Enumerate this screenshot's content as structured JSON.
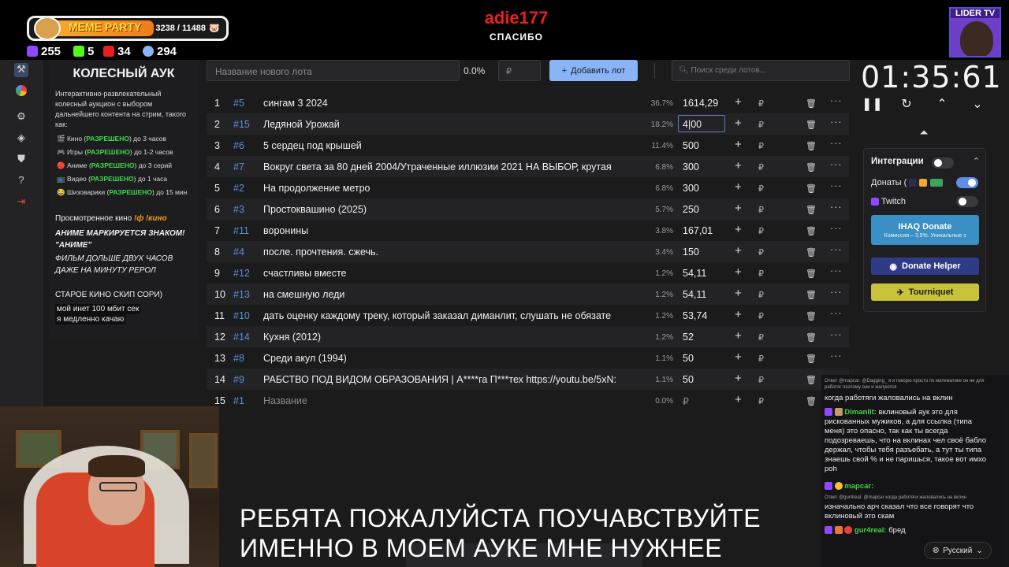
{
  "overlay": {
    "meme_party_label": "MEME PARTY",
    "meme_count": "3238 / 11488",
    "stats": [
      {
        "icon": "twitch-icon",
        "value": "255",
        "color": "#9146ff"
      },
      {
        "icon": "kick-icon",
        "value": "5",
        "color": "#53fc18"
      },
      {
        "icon": "live-icon",
        "value": "34",
        "color": "#e8201d"
      },
      {
        "icon": "viewers-icon",
        "value": "294",
        "color": "#8ab4f8"
      }
    ],
    "donor_name": "adie177",
    "thanks": "СПАСИБО",
    "lider_tv": "LIDER TV"
  },
  "sidebar_rules": {
    "title": "КОЛЕСНЫЙ АУК",
    "intro": "Интерактивно-развлекательный колесный аукцион с выбором дальнейшего контента на стрим, такого как:",
    "items": [
      {
        "before": "Кино (",
        "allowed": "РАЗРЕШЕНО",
        "after": ") до 3 часов"
      },
      {
        "before": "Игры (",
        "allowed": "РАЗРЕШЕНО",
        "after": ") до 1-2 часов"
      },
      {
        "before": "Аниме (",
        "allowed": "РАЗРЕШЕНО",
        "after": ") до 3 серий"
      },
      {
        "before": "Видео (",
        "allowed": "РАЗРЕШЕНО",
        "after": ") до 1 часа"
      },
      {
        "before": "Шизоварики (",
        "allowed": "РАЗРЕШЕНО",
        "after": ") до 15 мин"
      }
    ],
    "watched_prefix": "Просмотренное кино",
    "watched_cmd": "!ф !кино",
    "anime_note": "АНИМЕ МАРКИРУЕТСЯ ЗНАКОМ! \"АНИМЕ\"",
    "film_note": "ФИЛЬМ ДОЛЬШЕ ДВУХ ЧАСОВ ДАЖЕ НА МИНУТУ РЕРОЛ",
    "old_cinema": "СТАРОЕ КИНО СКИП СОРИ)",
    "internet_1": "мой инет 100 мбит сек",
    "internet_2": "я медленно качаю"
  },
  "controls": {
    "lot_placeholder": "Название нового лота",
    "percent": "0.0%",
    "currency_placeholder": "₽",
    "add_button": "Добавить лот",
    "search_placeholder": "Поиск среди лотов..."
  },
  "lots": [
    {
      "num": "1",
      "id": "#5",
      "name": "сингам 3 2024",
      "pct": "36.7%",
      "amount": "1614,29"
    },
    {
      "num": "2",
      "id": "#15",
      "name": " Ледяной Урожай",
      "pct": "18.2%",
      "amount": "4|00"
    },
    {
      "num": "3",
      "id": "#6",
      "name": "5 сердец под крышей",
      "pct": "11.4%",
      "amount": "500"
    },
    {
      "num": "4",
      "id": "#7",
      "name": "Вокруг света за 80 дней 2004/Утраченные иллюзии 2021 НА ВЫБОР, крутая",
      "pct": "6.8%",
      "amount": "300"
    },
    {
      "num": "5",
      "id": "#2",
      "name": "На продолжение метро",
      "pct": "6.8%",
      "amount": "300"
    },
    {
      "num": "6",
      "id": "#3",
      "name": "Простоквашино (2025)",
      "pct": "5.7%",
      "amount": "250"
    },
    {
      "num": "7",
      "id": "#11",
      "name": "воронины",
      "pct": "3.8%",
      "amount": "167,01"
    },
    {
      "num": "8",
      "id": "#4",
      "name": "после. прочтения. сжечь.",
      "pct": "3.4%",
      "amount": "150"
    },
    {
      "num": "9",
      "id": "#12",
      "name": " счастливы вместе",
      "pct": "1.2%",
      "amount": "54,11"
    },
    {
      "num": "10",
      "id": "#13",
      "name": " на смешную леди",
      "pct": "1.2%",
      "amount": "54,11"
    },
    {
      "num": "11",
      "id": "#10",
      "name": " дать оценку каждому треку, который заказал диманлит, слушать не обязате",
      "pct": "1.2%",
      "amount": "53,74"
    },
    {
      "num": "12",
      "id": "#14",
      "name": " Кухня (2012)",
      "pct": "1.2%",
      "amount": "52"
    },
    {
      "num": "13",
      "id": "#8",
      "name": "Среди акул (1994)",
      "pct": "1.1%",
      "amount": "50"
    },
    {
      "num": "14",
      "id": "#9",
      "name": "РАБСТВО ПОД ВИДОМ ОБРАЗОВАНИЯ | А****га П***тех https://youtu.be/5xN:",
      "pct": "1.1%",
      "amount": "50"
    },
    {
      "num": "15",
      "id": "#1",
      "name": "Название",
      "pct": "0.0%",
      "amount": "₽"
    }
  ],
  "row_currency": "₽",
  "timer": {
    "value": "01:35:61"
  },
  "integrations": {
    "title": "Интеграции",
    "donations_label": "Донаты (",
    "twitch_label": "Twitch",
    "ihaq_title": "IHAQ Donate",
    "ihaq_sub": "Комиссия – 3,5%. Уникальные з",
    "donate_helper": "Donate Helper",
    "tourniquet": "Tourniquet"
  },
  "chat": {
    "reply1": "Ответ @mapcar: @Dagging_ я и говорю просто по математике он не для работяг поэтому они и жалуются",
    "msg1": "когда работяги жаловались на вклин",
    "user2": "Dimanlit:",
    "msg2": "вклиновый аук это для рискованных мужиков, а для ссылка (типа меня) это опасно, так как ты всегда подозреваешь, что на вклинах чел своё бабло держал, чтобы тебя разъебать, а тут ты типа знаешь свой % и не паришься, такое вот имхо poh",
    "user3": "mapcar:",
    "reply3": "Ответ @gur4real: @mapcar когда работяги жаловались на вклин",
    "msg3": "изначально арч сказал что все говорят что вклиновый это скам",
    "user4": "gur4real:",
    "msg4": "бред",
    "language": "Русский"
  },
  "subtitles": {
    "line1": "РЕБЯТА ПОЖАЛУЙСТА ПОУЧАВСТВУЙТЕ",
    "line2": "ИМЕННО В МОЕМ АУКЕ МНЕ НУЖНЕЕ"
  }
}
